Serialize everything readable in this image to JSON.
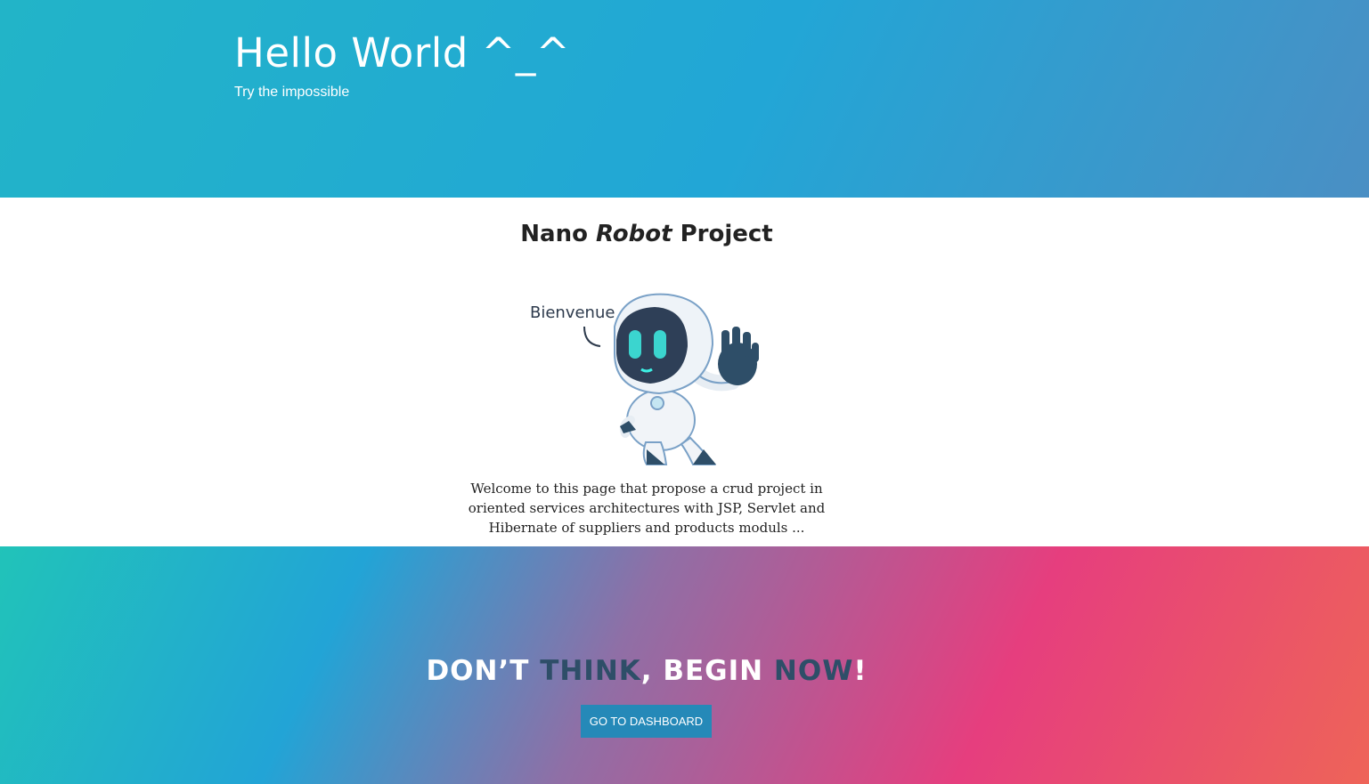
{
  "hero": {
    "title": "Hello World ^_^",
    "subtitle": "Try the impossible"
  },
  "project": {
    "title_part1": "Nano",
    "title_emphasis": "Robot",
    "title_part2": "Project",
    "bubble_text": "Bienvenue",
    "welcome_text": "Welcome to this page that propose a crud project in oriented services architectures with JSP, Servlet and Hibernate of suppliers and products moduls ..."
  },
  "cta": {
    "word1": "DON’T ",
    "word2": "THINK",
    "word3": ", BEGIN ",
    "word4": "NOW",
    "word5": "!",
    "button_label": "GO TO DASHBOARD"
  },
  "colors": {
    "hero_gradient_start": "#22b4c8",
    "hero_gradient_end": "#4a8fc4",
    "cta_dark_word": "#2e4e68",
    "button_bg": "#2589b8",
    "cta_pink": "#e63e7e"
  },
  "icons": {
    "robot": "robot-illustration"
  }
}
